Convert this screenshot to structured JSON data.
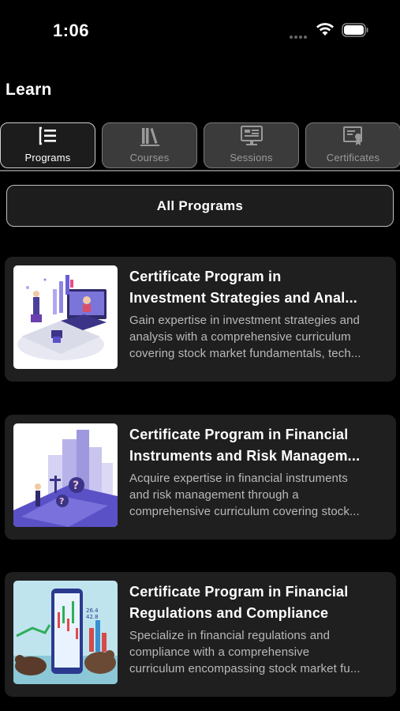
{
  "status_bar": {
    "time": "1:06"
  },
  "page": {
    "title": "Learn"
  },
  "tabs": [
    {
      "label": "Programs",
      "icon": "list-icon",
      "active": true
    },
    {
      "label": "Courses",
      "icon": "books-icon",
      "active": false
    },
    {
      "label": "Sessions",
      "icon": "monitor-icon",
      "active": false
    },
    {
      "label": "Certificates",
      "icon": "certificate-icon",
      "active": false
    }
  ],
  "filter": {
    "label": "All Programs"
  },
  "programs": [
    {
      "title_line1": "Certificate Program in",
      "title_line2": "Investment Strategies and Anal...",
      "desc_line1": "Gain expertise in investment strategies and",
      "desc_line2": "analysis with a comprehensive curriculum",
      "desc_line3": "covering stock market fundamentals, tech..."
    },
    {
      "title_line1": "Certificate Program in Financial",
      "title_line2": "Instruments and Risk Managem...",
      "desc_line1": "Acquire expertise in financial instruments",
      "desc_line2": "and risk management through a",
      "desc_line3": "comprehensive curriculum covering stock..."
    },
    {
      "title_line1": "Certificate Program in Financial",
      "title_line2": "Regulations and Compliance",
      "desc_line1": "Specialize in financial regulations and",
      "desc_line2": "compliance with a comprehensive",
      "desc_line3": "curriculum encompassing stock market fu..."
    }
  ],
  "colors": {
    "background": "#000000",
    "card": "#1f1f1f",
    "tab_inactive": "#3b3b3b",
    "text_secondary": "#b9b9b9"
  }
}
